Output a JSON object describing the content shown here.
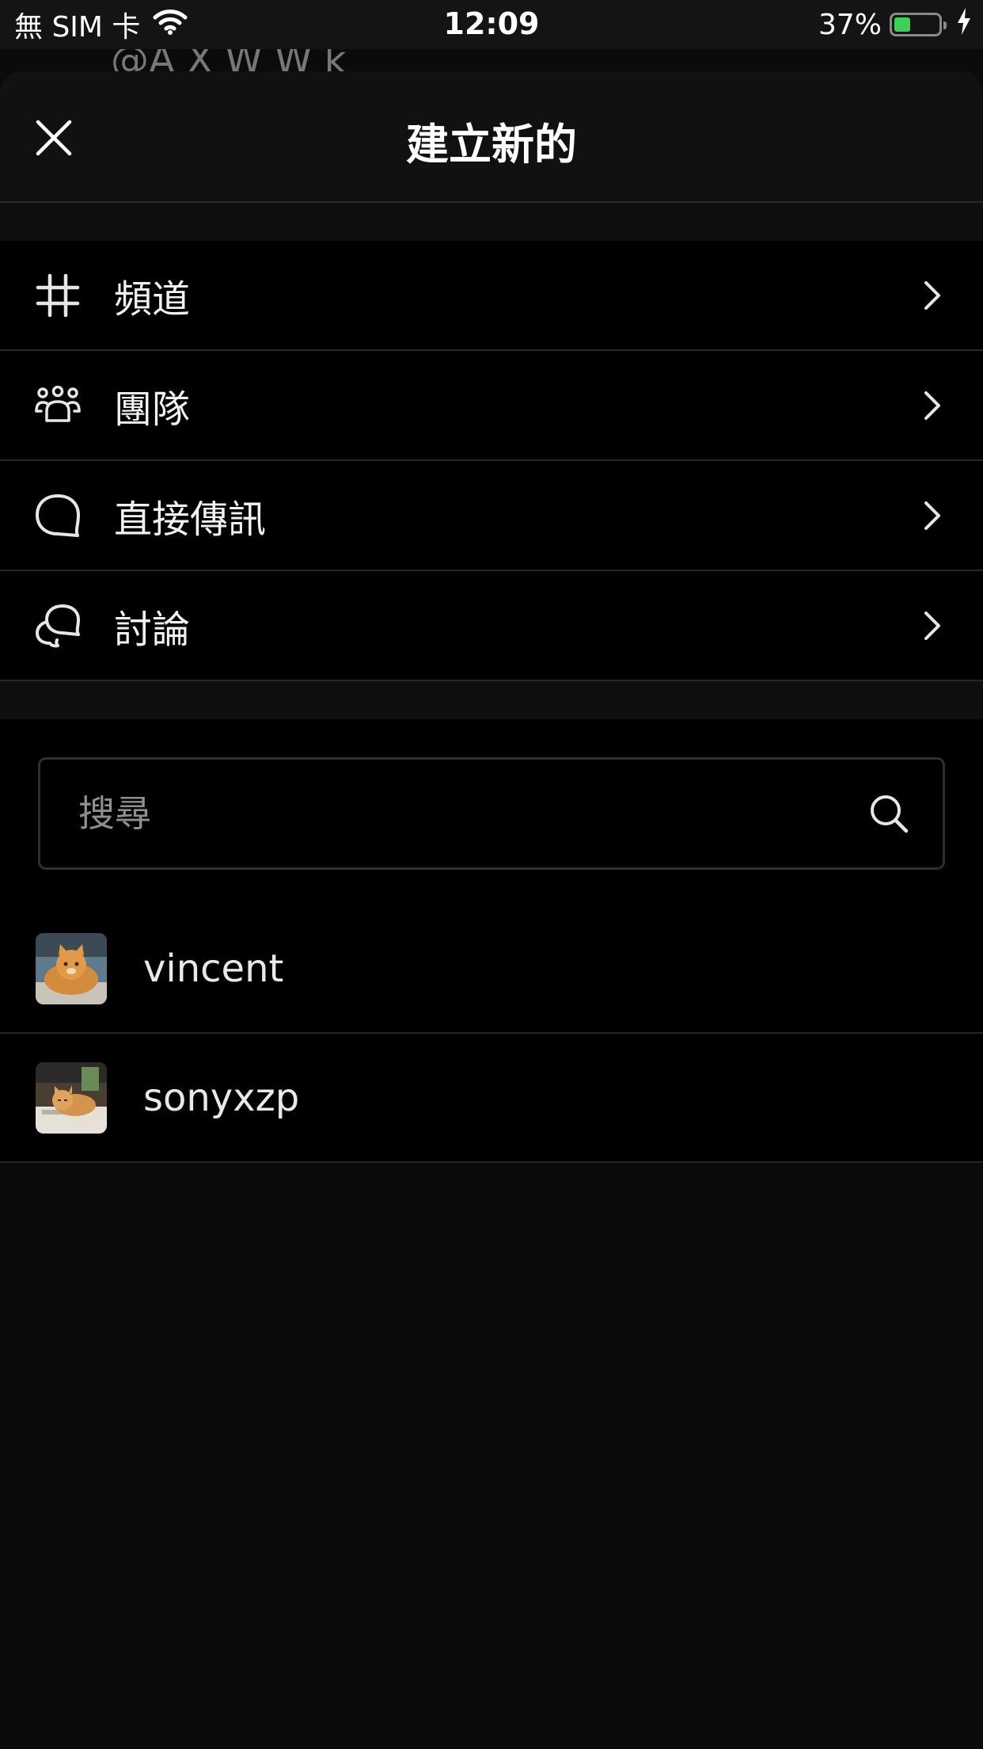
{
  "status_bar": {
    "carrier": "無 SIM 卡",
    "time": "12:09",
    "battery_percent": "37%",
    "battery_level": 0.37,
    "battery_color": "#3ed15a"
  },
  "background_text": "@A    X W W  k",
  "sheet": {
    "title": "建立新的",
    "close_icon": "close-icon"
  },
  "menu": {
    "items": [
      {
        "label": "頻道",
        "icon": "hash-icon"
      },
      {
        "label": "團隊",
        "icon": "team-icon"
      },
      {
        "label": "直接傳訊",
        "icon": "message-bubble-icon"
      },
      {
        "label": "討論",
        "icon": "discussion-icon"
      }
    ]
  },
  "search": {
    "placeholder": "搜尋",
    "value": ""
  },
  "users": [
    {
      "name": "vincent",
      "avatar": "orange-cat-avatar"
    },
    {
      "name": "sonyxzp",
      "avatar": "cat-on-desk-avatar"
    }
  ]
}
